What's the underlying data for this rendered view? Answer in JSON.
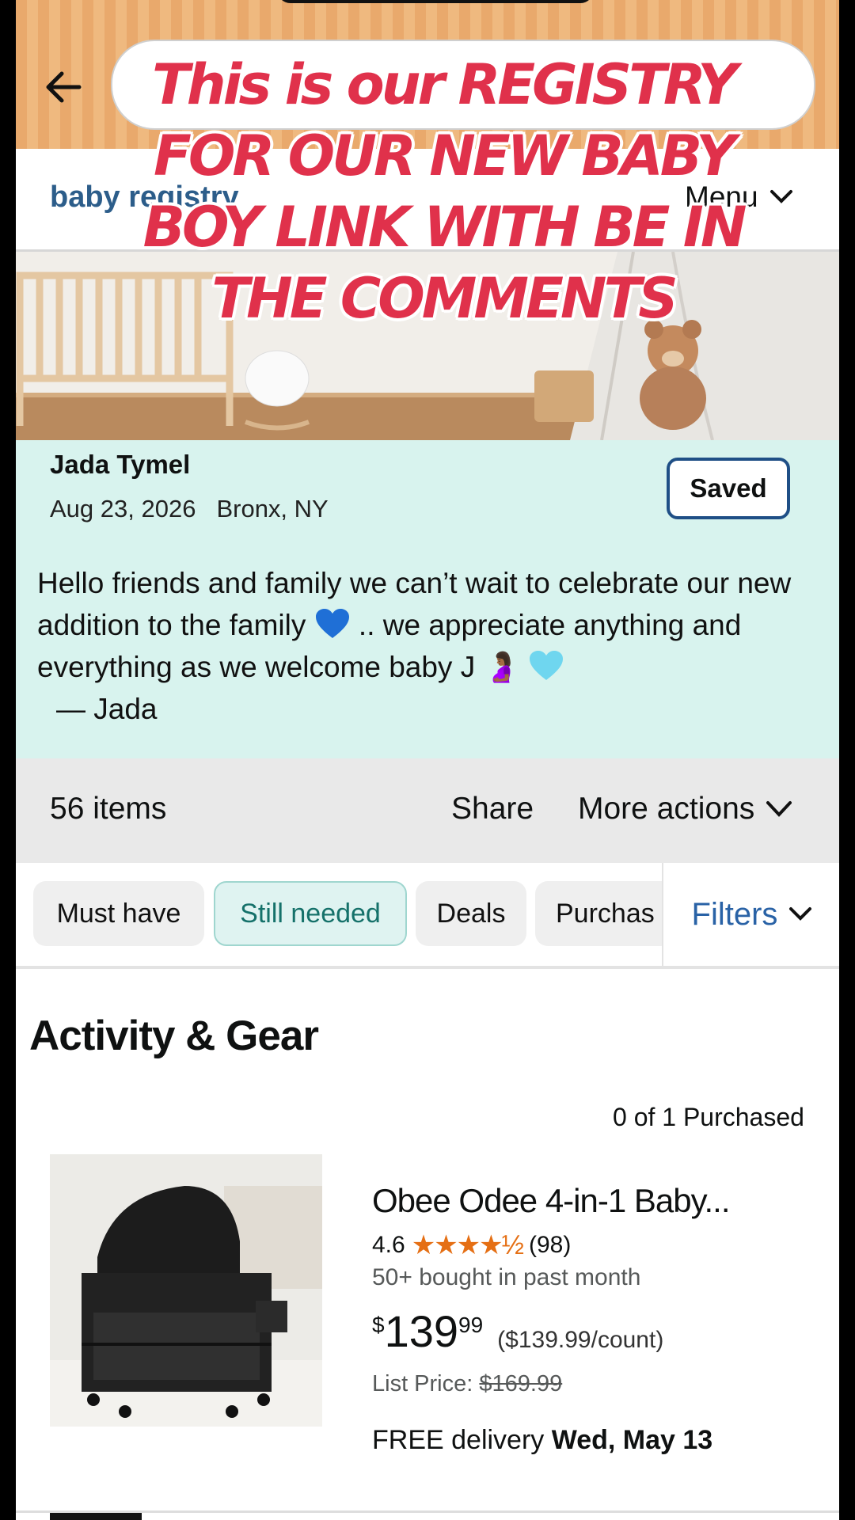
{
  "overlay_caption": "This is our REGISTRY FOR OUR NEW BABY BOY LINK WITH BE IN THE COMMENTS",
  "header": {
    "brand": "baby registry",
    "menu_label": "Menu"
  },
  "profile": {
    "name": "Jada Tymel",
    "date": "Aug 23, 2026",
    "location": "Bronx, NY",
    "saved_label": "Saved",
    "message_part1": "Hello friends and family we can’t wait to celebrate our new addition to the family",
    "message_part2": ".. we appreciate anything and everything as we welcome baby J",
    "message_emoji_pregnant": "🤰🏾",
    "signature": "— Jada"
  },
  "actions": {
    "count": "56 items",
    "share": "Share",
    "more": "More actions"
  },
  "chips": [
    "Must have",
    "Still needed",
    "Deals",
    "Purchas"
  ],
  "filters_label": "Filters",
  "section_title": "Activity & Gear",
  "product": {
    "purchased": "0 of 1 Purchased",
    "title": "Obee Odee 4-in-1 Baby...",
    "rating": "4.6",
    "stars": "★★★★½",
    "reviews": "(98)",
    "bought": "50+ bought in past month",
    "price_currency": "$",
    "price_whole": "139",
    "price_fraction": "99",
    "price_unit": "($139.99/count)",
    "list_label": "List Price:",
    "list_price": "$169.99",
    "delivery_label": "FREE delivery",
    "delivery_date": "Wed, May 13"
  },
  "colors": {
    "accent_blue": "#2c5d8a",
    "profile_bg": "#d8f3ee",
    "overlay_red": "#e0314b",
    "star": "#e56f14"
  }
}
